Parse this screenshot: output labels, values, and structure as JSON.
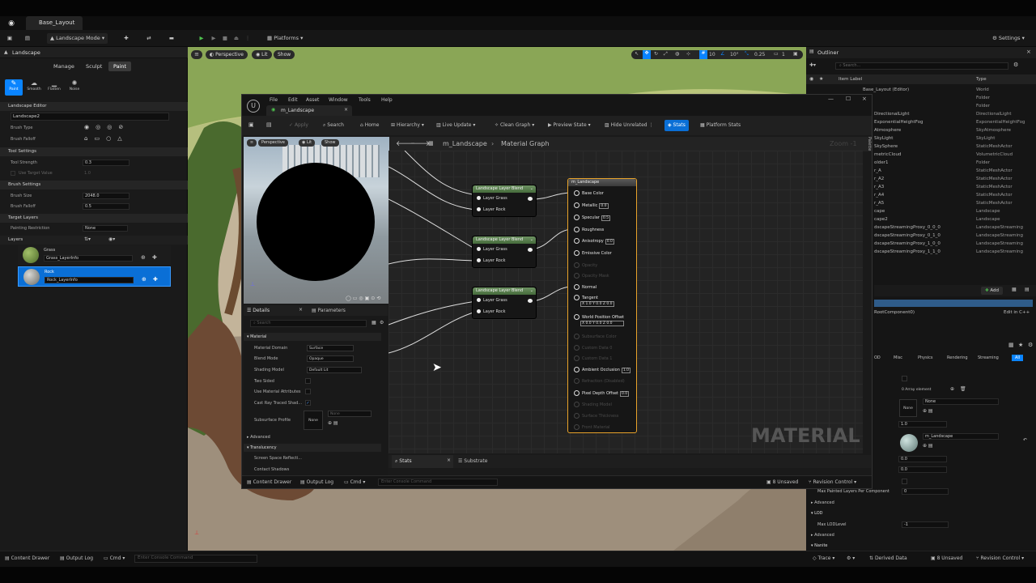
{
  "window": {
    "tab_title": "Base_Layout"
  },
  "toolbar": {
    "mode": "Landscape Mode",
    "platforms": "Platforms",
    "settings": "Settings"
  },
  "viewport": {
    "perspective": "Perspective",
    "lit": "Lit",
    "show": "Show",
    "grid_snap": "10",
    "rot_snap": "10°",
    "scale_snap": "0.25",
    "camera_speed": "1"
  },
  "landscape_panel": {
    "title": "Landscape",
    "tabs": [
      "Manage",
      "Sculpt",
      "Paint"
    ],
    "tools": [
      "Paint",
      "Smooth",
      "Flatten",
      "Noise"
    ],
    "editor_section": "Landscape Editor",
    "landscape_name": "Landscape2",
    "brush_type_label": "Brush Type",
    "brush_falloff_label": "Brush Falloff",
    "tool_settings_section": "Tool Settings",
    "tool_strength_label": "Tool Strength",
    "tool_strength_value": "0.3",
    "use_target_value_label": "Use Target Value",
    "target_value": "1.0",
    "brush_settings_section": "Brush Settings",
    "brush_size_label": "Brush Size",
    "brush_size_value": "2048.0",
    "brush_falloff2_label": "Brush Falloff",
    "brush_falloff_value": "0.5",
    "target_layers_section": "Target Layers",
    "painting_restriction_label": "Painting Restriction",
    "painting_restriction_value": "None",
    "layers_section": "Layers",
    "layers": [
      {
        "name": "Grass",
        "info": "Grass_LayerInfo"
      },
      {
        "name": "Rock",
        "info": "Rock_LayerInfo"
      }
    ]
  },
  "material_editor": {
    "menu": [
      "File",
      "Edit",
      "Asset",
      "Window",
      "Tools",
      "Help"
    ],
    "tab": "m_Landscape",
    "toolbar": [
      "Apply",
      "Search",
      "Home",
      "Hierarchy",
      "Live Update",
      "Clean Graph",
      "Preview State",
      "Hide Unrelated",
      "Stats",
      "Platform Stats"
    ],
    "preview": {
      "perspective": "Perspective",
      "lit": "Lit",
      "show": "Show"
    },
    "breadcrumb_asset": "m_Landscape",
    "breadcrumb_graph": "Material Graph",
    "zoom": "Zoom -1",
    "palette": "Palette",
    "watermark": "MATERIAL",
    "details_tab": "Details",
    "parameters_tab": "Parameters",
    "search_placeholder": "Search",
    "details": {
      "material_section": "Material",
      "rows": [
        {
          "label": "Material Domain",
          "value": "Surface"
        },
        {
          "label": "Blend Mode",
          "value": "Opaque"
        },
        {
          "label": "Shading Model",
          "value": "Default Lit"
        },
        {
          "label": "Two Sided",
          "value": ""
        },
        {
          "label": "Use Material Attributes",
          "value": ""
        },
        {
          "label": "Cast Ray Traced Shad...",
          "value": ""
        }
      ],
      "subsurface_label": "Subsurface Profile",
      "subsurface_value": "None",
      "subsurface_dropdown": "None",
      "advanced": "Advanced",
      "translucency_section": "Translucency",
      "ssr_label": "Screen Space Reflecti...",
      "contact_shadows_label": "Contact Shadows"
    },
    "blend_nodes": [
      {
        "title": "Landscape Layer Blend",
        "pins": [
          "Layer Grass",
          "Layer Rock"
        ]
      },
      {
        "title": "Landscape Layer Blend",
        "pins": [
          "Layer Grass",
          "Layer Rock"
        ]
      },
      {
        "title": "Landscape Layer Blend",
        "pins": [
          "Layer Grass",
          "Layer Rock"
        ]
      }
    ],
    "result_node": {
      "title": "m_Landscape",
      "pins": [
        {
          "name": "Base Color",
          "value": ""
        },
        {
          "name": "Metallic",
          "value": "0.0"
        },
        {
          "name": "Specular",
          "value": "0.5"
        },
        {
          "name": "Roughness",
          "value": ""
        },
        {
          "name": "Anisotropy",
          "value": "0.0"
        },
        {
          "name": "Emissive Color",
          "value": ""
        },
        {
          "name": "Opacity",
          "value": "",
          "disabled": true
        },
        {
          "name": "Opacity Mask",
          "value": "",
          "disabled": true
        },
        {
          "name": "Normal",
          "value": ""
        },
        {
          "name": "Tangent",
          "value": "X 1.0 Y 0.0 Z 0.0"
        },
        {
          "name": "World Position Offset",
          "value": "X 0.0 Y 0.0 Z 0.0"
        },
        {
          "name": "Subsurface Color",
          "value": "",
          "disabled": true
        },
        {
          "name": "Custom Data 0",
          "value": "",
          "disabled": true
        },
        {
          "name": "Custom Data 1",
          "value": "",
          "disabled": true
        },
        {
          "name": "Ambient Occlusion",
          "value": "1.0"
        },
        {
          "name": "Refraction (Disabled)",
          "value": "",
          "disabled": true
        },
        {
          "name": "Pixel Depth Offset",
          "value": "0.0"
        },
        {
          "name": "Shading Model",
          "value": "",
          "disabled": true
        },
        {
          "name": "Surface Thickness",
          "value": "",
          "disabled": true
        },
        {
          "name": "Front Material",
          "value": "",
          "disabled": true
        }
      ]
    },
    "stats_tab": "Stats",
    "substrate_tab": "Substrate",
    "bottom": {
      "content_drawer": "Content Drawer",
      "output_log": "Output Log",
      "cmd": "Cmd",
      "console_placeholder": "Enter Console Command",
      "unsaved": "8 Unsaved",
      "revision": "Revision Control"
    }
  },
  "outliner": {
    "title": "Outliner",
    "search_placeholder": "Search...",
    "col_label": "Item Label",
    "col_type": "Type",
    "rows": [
      {
        "label": "Base_Layout (Editor)",
        "type": "World"
      },
      {
        "label": "",
        "type": "Folder"
      },
      {
        "label": "",
        "type": "Folder"
      },
      {
        "label": "DirectionalLight",
        "type": "DirectionalLight"
      },
      {
        "label": "ExponentialHeightFog",
        "type": "ExponentialHeightFog"
      },
      {
        "label": "Atmosphere",
        "type": "SkyAtmosphere"
      },
      {
        "label": "SkyLight",
        "type": "SkyLight"
      },
      {
        "label": "SkySphere",
        "type": "StaticMeshActor"
      },
      {
        "label": "metricCloud",
        "type": "VolumetricCloud"
      },
      {
        "label": "older1",
        "type": "Folder"
      },
      {
        "label": "r_A",
        "type": "StaticMeshActor"
      },
      {
        "label": "r_A2",
        "type": "StaticMeshActor"
      },
      {
        "label": "r_A3",
        "type": "StaticMeshActor"
      },
      {
        "label": "r_A4",
        "type": "StaticMeshActor"
      },
      {
        "label": "r_A5",
        "type": "StaticMeshActor"
      },
      {
        "label": "cape",
        "type": "Landscape"
      },
      {
        "label": "cape2",
        "type": "Landscape"
      },
      {
        "label": "dscapeStreamingProxy_0_0_0",
        "type": "LandscapeStreaming"
      },
      {
        "label": "dscapeStreamingProxy_0_1_0",
        "type": "LandscapeStreaming"
      },
      {
        "label": "dscapeStreamingProxy_1_0_0",
        "type": "LandscapeStreaming"
      },
      {
        "label": "dscapeStreamingProxy_1_1_0",
        "type": "LandscapeStreaming"
      }
    ]
  },
  "details_right": {
    "add": "Add",
    "root_component": "RootComponent0)",
    "edit_cpp": "Edit in C++",
    "filters": [
      "OD",
      "Misc",
      "Physics",
      "Rendering",
      "Streaming",
      "All"
    ],
    "array_element": "0 Array element",
    "none1": "None",
    "none2": "None",
    "v1": "1.0",
    "material": "m_Landscape",
    "v2": "0.0",
    "v3": "0.0",
    "max_painted_label": "Max Painted Layers Per Component",
    "max_painted_value": "0",
    "advanced1": "Advanced",
    "lod_section": "LOD",
    "max_lod_label": "Max LODLevel",
    "max_lod_value": "-1",
    "advanced2": "Advanced",
    "nanite_section": "Nanite"
  },
  "bottom_bar": {
    "content_drawer": "Content Drawer",
    "output_log": "Output Log",
    "cmd": "Cmd",
    "console_placeholder": "Enter Console Command",
    "trace": "Trace",
    "derived_data": "Derived Data",
    "unsaved": "8 Unsaved",
    "revision": "Revision Control"
  }
}
